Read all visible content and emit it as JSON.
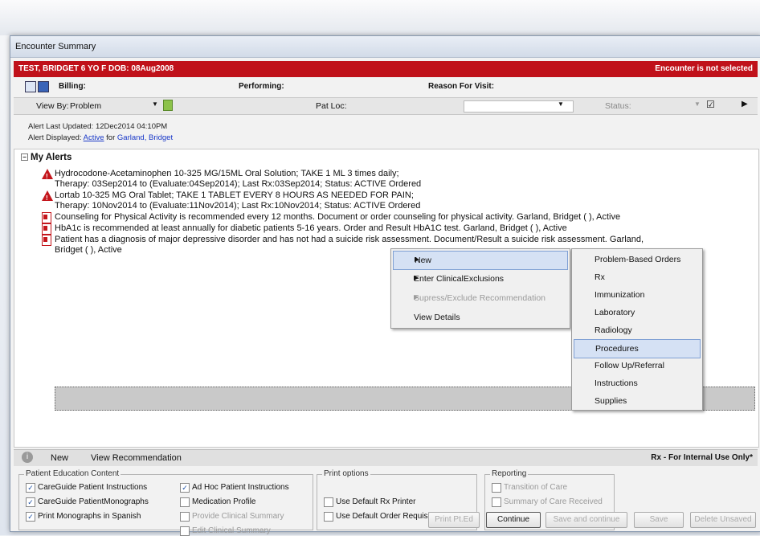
{
  "window": {
    "title": "Encounter Summary"
  },
  "patient_bar": {
    "left": "TEST, BRIDGET  6 YO  F DOB: 08Aug2008",
    "right": "Encounter is not selected"
  },
  "header_row": {
    "billing": "Billing:",
    "performing": "Performing:",
    "reason": "Reason For Visit:"
  },
  "filter_row": {
    "view_by_label": "View By:",
    "view_by_value": "Problem",
    "pat_loc": "Pat Loc:",
    "status": "Status:"
  },
  "alert_info": {
    "updated": "Alert Last Updated: 12Dec2014 04:10PM",
    "displayed_prefix": "Alert Displayed:",
    "displayed_link": "Active",
    "for_text": "for",
    "patient_link": "Garland, Bridget"
  },
  "alerts": {
    "heading": "My Alerts",
    "items": [
      {
        "line1": "Hydrocodone-Acetaminophen 10-325 MG/15ML Oral Solution; TAKE 1 ML 3 times daily;",
        "line2": "Therapy: 03Sep2014 to (Evaluate:04Sep2014); Last Rx:03Sep2014; Status: ACTIVE Ordered"
      },
      {
        "line1": "Lortab 10-325 MG Oral Tablet; TAKE 1 TABLET EVERY 8 HOURS AS NEEDED FOR PAIN;",
        "line2": "Therapy: 10Nov2014 to (Evaluate:11Nov2014); Last Rx:10Nov2014; Status: ACTIVE Ordered"
      },
      {
        "line1": "Counseling for Physical Activity is recommended every 12 months. Document or order counseling for physical activity. Garland, Bridget ( ), Active"
      },
      {
        "line1": "HbA1c is recommended at least annually for diabetic patients 5-16 years. Order and Result HbA1C test. Garland, Bridget ( ), Active"
      },
      {
        "line1": "Patient has a diagnosis of major depressive disorder and has not had a suicide risk assessment. Document/Result a suicide risk assessment. Garland,",
        "line2": "Bridget ( ), Active"
      }
    ]
  },
  "context_menu": {
    "items": [
      "New",
      "Enter ClinicalExclusions",
      "Supress/Exclude Recommendation",
      "View Details"
    ]
  },
  "submenu": {
    "items": [
      "Problem-Based Orders",
      "Rx",
      "Immunization",
      "Laboratory",
      "Radiology",
      "Procedures",
      "Follow Up/Referral",
      "Instructions",
      "Supplies"
    ],
    "highlighted": "Procedures"
  },
  "bottom_bar": {
    "new": "New",
    "view_rec": "View Recommendation",
    "right": "Rx - For Internal Use Only*"
  },
  "patient_education": {
    "caption": "Patient Education Content",
    "col1": [
      {
        "label": "CareGuide Patient Instructions",
        "checked": true
      },
      {
        "label": "CareGuide PatientMonographs",
        "checked": true
      },
      {
        "label": "Print Monographs in Spanish",
        "checked": true
      }
    ],
    "col2": [
      {
        "label": "Ad Hoc Patient Instructions",
        "checked": true
      },
      {
        "label": "Medication Profile",
        "checked": false
      },
      {
        "label": "Provide Clinical Summary",
        "checked": false
      },
      {
        "label": "Edit Clinical Summary",
        "checked": false
      }
    ]
  },
  "print_options": {
    "caption": "Print options",
    "items": [
      {
        "label": "Use Default Rx Printer",
        "checked": false
      },
      {
        "label": "Use Default Order Requisition Printer",
        "checked": false
      }
    ]
  },
  "reporting": {
    "caption": "Reporting",
    "items": [
      {
        "label": "Transition of Care",
        "checked": false
      },
      {
        "label": "Summary of Care Received",
        "checked": false
      }
    ]
  },
  "buttons": {
    "print_pted": "Print Pt.Ed",
    "continue": "Continue",
    "save_continue": "Save and continue",
    "save": "Save",
    "delete_unsaved": "Delete Unsaved"
  },
  "colors": {
    "patient_bar": "#c0111a",
    "alert_red": "#c4161c",
    "link": "#1a39c8",
    "highlight": "#d5e1f4"
  }
}
